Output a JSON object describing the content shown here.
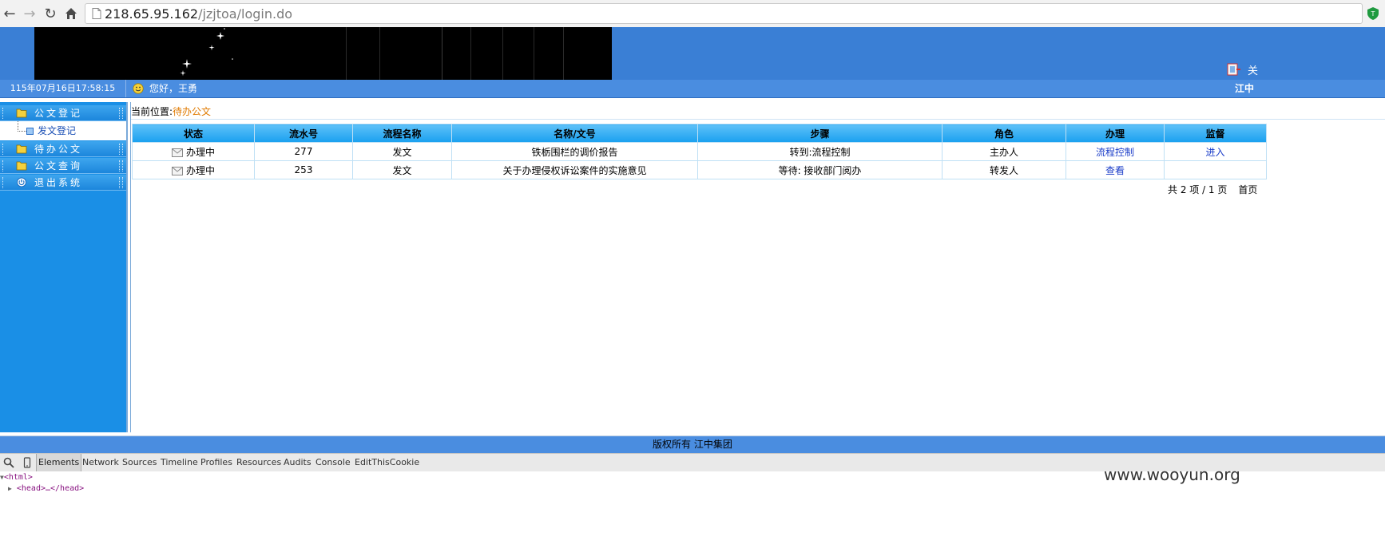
{
  "browser": {
    "url_host": "218.65.95.162",
    "url_path": "/jzjtoa/login.do"
  },
  "header": {
    "tool_text": "关"
  },
  "status_bar": {
    "datetime": "115年07月16日17:58:15",
    "greeting": "您好，王勇",
    "company_short": "江中"
  },
  "sidebar": {
    "menus": [
      {
        "label": "公文登记"
      },
      {
        "label": "待办公文"
      },
      {
        "label": "公文查询"
      },
      {
        "label": "退出系统"
      }
    ],
    "submenu_item": "发文登记"
  },
  "breadcrumb": {
    "prefix": "当前位置:",
    "current": "待办公文"
  },
  "table": {
    "headers": [
      "状态",
      "流水号",
      "流程名称",
      "名称/文号",
      "步骤",
      "角色",
      "办理",
      "监督"
    ],
    "rows": [
      {
        "status": "办理中",
        "serial": "277",
        "process": "发文",
        "title": "铁栃围栏的调价报告",
        "step": "转到:流程控制",
        "role": "主办人",
        "action": "流程控制",
        "supervise": "进入"
      },
      {
        "status": "办理中",
        "serial": "253",
        "process": "发文",
        "title": "关于办理侵权诉讼案件的实施意见",
        "step": "等待: 接收部门阅办",
        "role": "转发人",
        "action": "查看",
        "supervise": ""
      }
    ]
  },
  "pagination": {
    "summary": "共 2 项 / 1 页",
    "first": "首页"
  },
  "footer": {
    "text": "版权所有 江中集团"
  },
  "devtools": {
    "tabs": [
      "Elements",
      "Network",
      "Sources",
      "Timeline",
      "Profiles",
      "Resources",
      "Audits",
      "Console",
      "EditThisCookie"
    ],
    "dom": [
      "<html>",
      "<head>…</head>"
    ]
  },
  "watermark": "www.wooyun.org"
}
